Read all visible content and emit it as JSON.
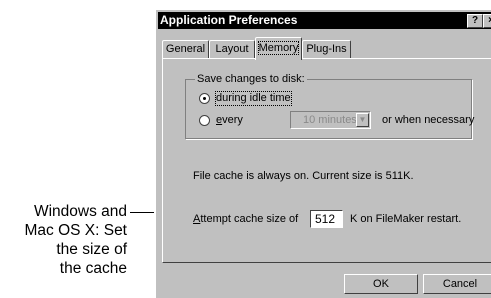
{
  "callout": {
    "lines": [
      "Windows and",
      "Mac OS X: Set",
      "the size of",
      "the cache"
    ]
  },
  "window": {
    "title": "Application Preferences",
    "help_glyph": "?",
    "close_glyph": "×"
  },
  "tabs": [
    {
      "label": "General",
      "selected": false
    },
    {
      "label": "Layout",
      "selected": false
    },
    {
      "label": "Memory",
      "selected": true
    },
    {
      "label": "Plug-Ins",
      "selected": false
    }
  ],
  "save_group": {
    "legend": "Save changes to disk:",
    "option_idle": {
      "label": "during idle time",
      "selected": true
    },
    "option_every": {
      "label_accel": "e",
      "label_rest": "very",
      "selected": false,
      "interval_value": "10 minutes",
      "interval_enabled": false,
      "suffix": "or when necessary"
    }
  },
  "file_cache": {
    "status_text": "File cache is always on.  Current size is 511K."
  },
  "cache_size": {
    "label_accel": "A",
    "label_rest": "ttempt cache size of",
    "value": "512",
    "suffix": "K on FileMaker restart."
  },
  "buttons": {
    "ok": "OK",
    "cancel": "Cancel"
  },
  "icons": {
    "radio": "radio-icon",
    "dropdown": "chevron-down-icon",
    "help": "help-icon",
    "close": "close-icon"
  }
}
